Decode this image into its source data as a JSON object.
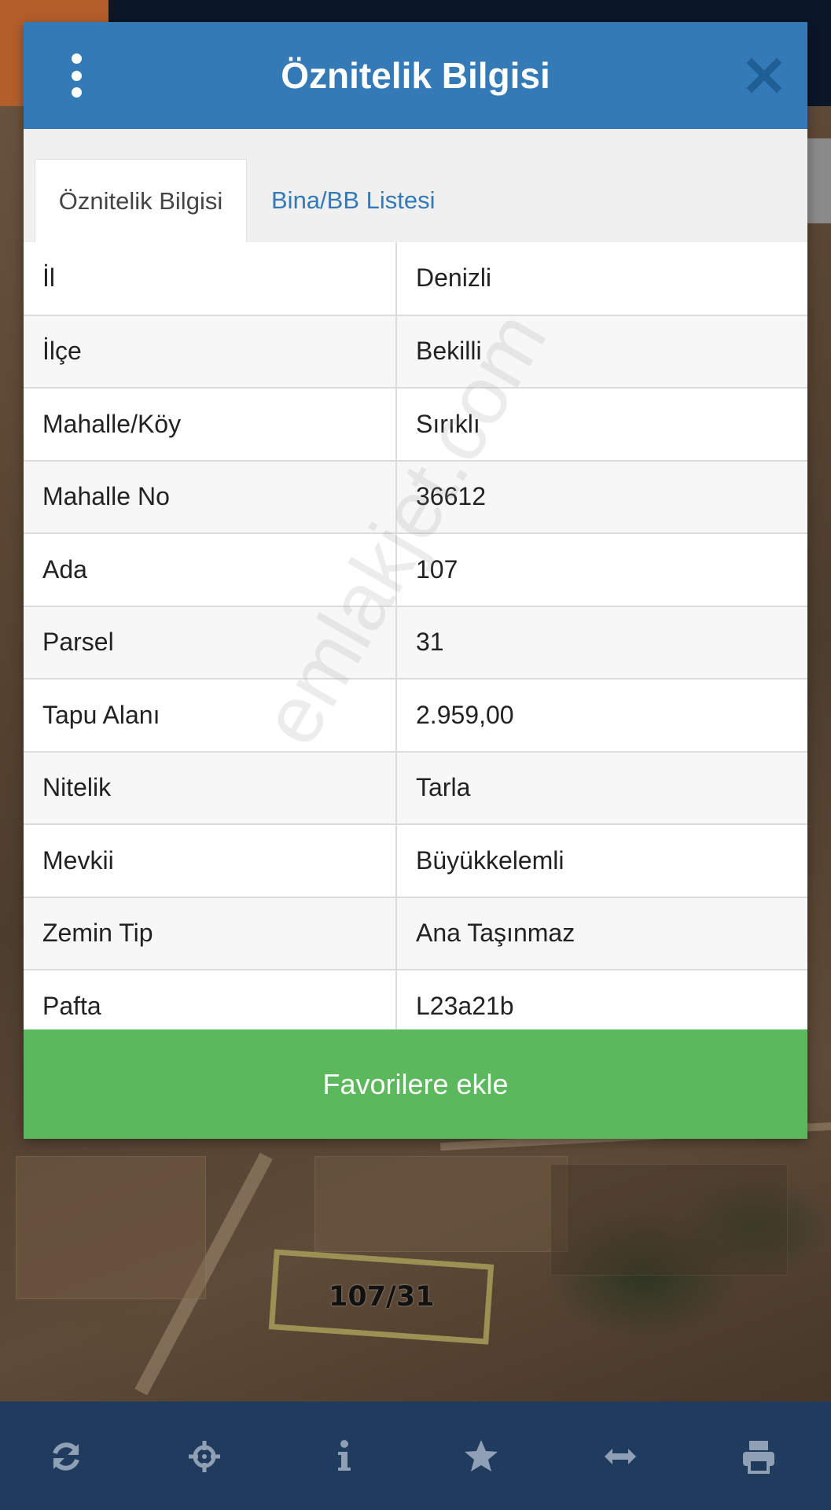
{
  "dialog": {
    "title": "Öznitelik Bilgisi",
    "tabs": [
      {
        "label": "Öznitelik Bilgisi",
        "active": true
      },
      {
        "label": "Bina/BB Listesi",
        "active": false
      }
    ],
    "rows": [
      {
        "key": "İl",
        "value": "Denizli"
      },
      {
        "key": "İlçe",
        "value": "Bekilli"
      },
      {
        "key": "Mahalle/Köy",
        "value": "Sırıklı"
      },
      {
        "key": "Mahalle No",
        "value": "36612"
      },
      {
        "key": "Ada",
        "value": "107"
      },
      {
        "key": "Parsel",
        "value": "31"
      },
      {
        "key": "Tapu Alanı",
        "value": "2.959,00"
      },
      {
        "key": "Nitelik",
        "value": "Tarla"
      },
      {
        "key": "Mevkii",
        "value": "Büyükkelemli"
      },
      {
        "key": "Zemin Tip",
        "value": "Ana Taşınmaz"
      },
      {
        "key": "Pafta",
        "value": "L23a21b"
      }
    ],
    "favorite_button_label": "Favorilere ekle"
  },
  "watermark": "emlakjet.com",
  "map": {
    "parcel_label": "107/31"
  },
  "toolbar": {
    "icons": [
      "refresh-icon",
      "crosshair-icon",
      "info-icon",
      "star-icon",
      "measure-icon",
      "print-icon"
    ]
  },
  "colors": {
    "header": "#337ab7",
    "favorite_button": "#5cb85c",
    "toolbar": "#1f3b5e",
    "tab_link": "#337ab7"
  }
}
